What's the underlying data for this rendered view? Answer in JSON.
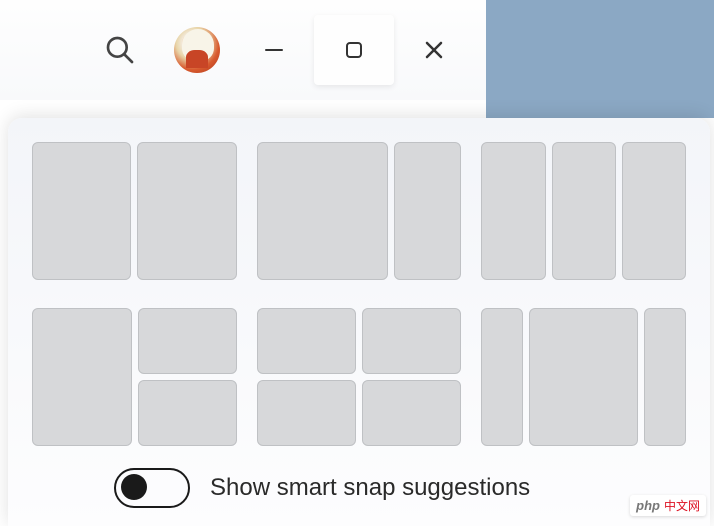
{
  "titlebar": {
    "search_icon": "search",
    "minimize_icon": "minimize",
    "maximize_icon": "maximize",
    "close_icon": "close"
  },
  "snap_panel": {
    "layouts": [
      {
        "id": "two-col-5050"
      },
      {
        "id": "two-col-7030"
      },
      {
        "id": "three-col"
      },
      {
        "id": "one-plus-two"
      },
      {
        "id": "quadrant"
      },
      {
        "id": "three-col-wide-center"
      }
    ],
    "toggle": {
      "state": "off",
      "label": "Show smart snap suggestions"
    }
  },
  "watermark": {
    "brand": "php",
    "text": "中文网"
  }
}
